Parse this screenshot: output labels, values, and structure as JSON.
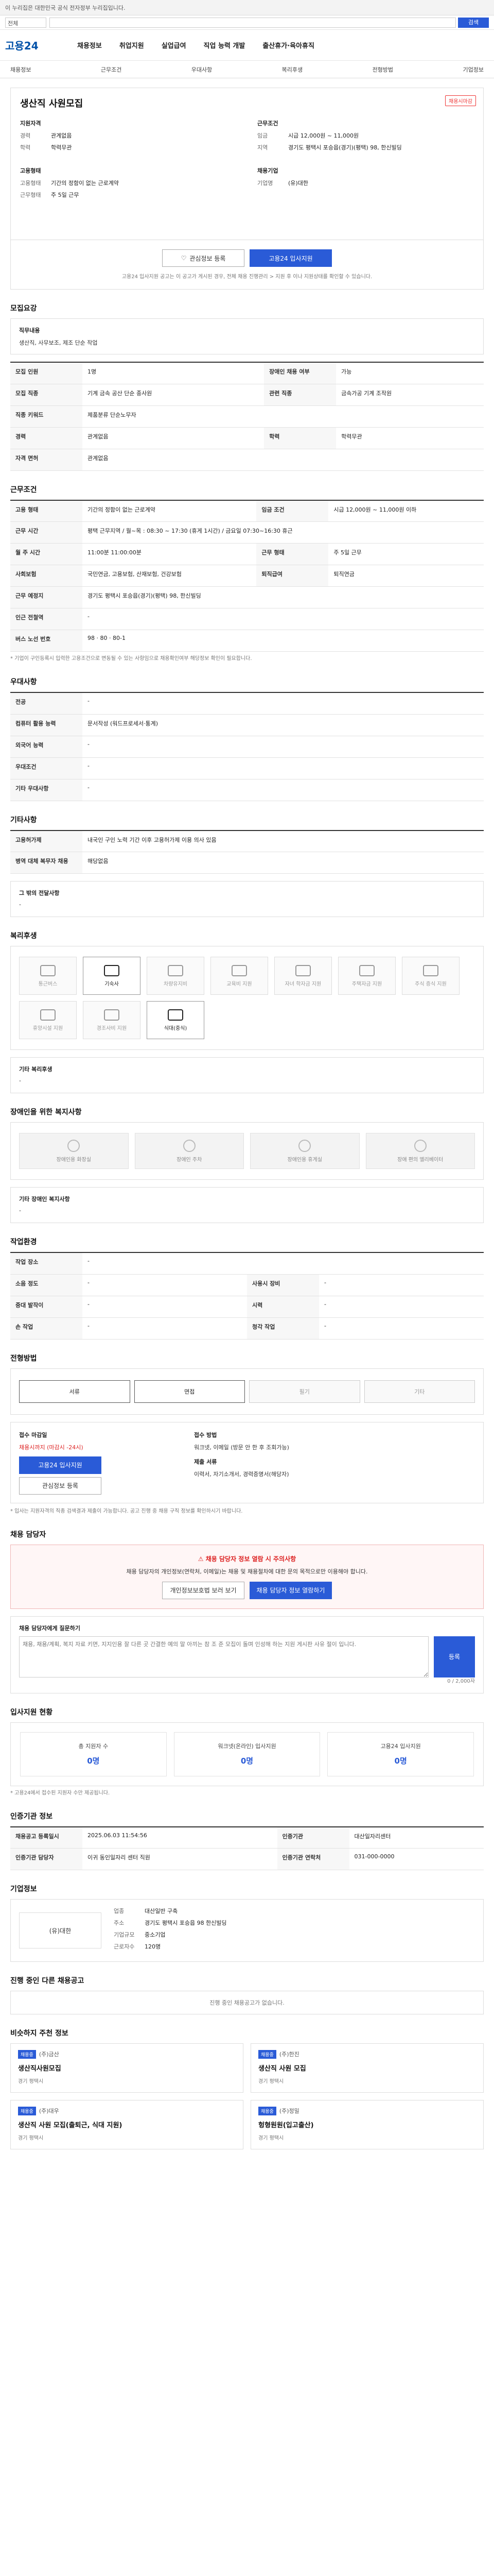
{
  "gov_bar": {
    "text": "이 누리집은 대한민국 공식 전자정부 누리집입니다."
  },
  "search": {
    "scope": "전체",
    "placeholder": "",
    "button": "검색"
  },
  "header": {
    "logo": "고용24",
    "gnb": [
      "채용정보",
      "취업지원",
      "실업급여",
      "직업 능력 개발",
      "출산휴가·육아휴직"
    ]
  },
  "subnav": [
    "채용정보",
    "근무조건",
    "우대사항",
    "복리후생",
    "전형방법",
    "기업정보"
  ],
  "summary": {
    "badge": "채용시마감",
    "title": "생산직 사원모집",
    "qual_head": "지원자격",
    "qual": [
      {
        "k": "경력",
        "v": "관계없음"
      },
      {
        "k": "학력",
        "v": "학력무관"
      }
    ],
    "work_head": "근무조건",
    "work": [
      {
        "k": "임금",
        "v": "시급 12,000원 ~ 11,000원"
      },
      {
        "k": "지역",
        "v": "경기도 평택시 포승읍(경기)(평택) 98, 한신빌딩"
      }
    ],
    "emp_head": "고용형태",
    "emp": [
      {
        "k": "고용형태",
        "v": "기간의 정함이 없는 근로계약"
      },
      {
        "k": "근무형태",
        "v": "주 5일 근무"
      }
    ],
    "corp_head": "채용기업",
    "corp": [
      {
        "k": "기업명",
        "v": "(유)대한"
      }
    ]
  },
  "actions": {
    "save": "관심정보 등록",
    "apply": "고용24 입사지원",
    "note": "고용24 입사지원 공고는 이 공고가 게시된 경우, 전체 채용 진행관리 > 지원 후 이나 지원상태를 확인할 수 있습니다."
  },
  "recruit": {
    "head": "모집요강",
    "duty_label": "직무내용",
    "duty": "생산직, 사무보조, 제조 단순 작업"
  },
  "recruit_table": [
    {
      "k": "모집 인원",
      "v": "1명",
      "k2": "장애인 채용 여부",
      "v2": "가능"
    },
    {
      "k": "모집 직종",
      "v": "기계 금속 공산 단순 종사원",
      "k2": "관련 직종",
      "v2": "금속가공 기계 조작원"
    },
    {
      "k": "직종 키워드",
      "v": "제품분류 단순노무자",
      "k2": "",
      "v2": ""
    },
    {
      "k": "경력",
      "v": "관계없음",
      "k2": "학력",
      "v2": "학력무관"
    },
    {
      "k": "자격 면허",
      "v": "관계없음",
      "k2": "",
      "v2": ""
    }
  ],
  "conditions": {
    "head": "근무조건"
  },
  "cond_table": [
    {
      "k": "고용 형태",
      "v": "기간의 정함이 없는 근로계약",
      "k2": "임금 조건",
      "v2": "시급 12,000원 ~ 11,000원 이하"
    },
    {
      "k": "근무 시간",
      "v": "평택 근무지역 / 월~목 : 08:30 ~ 17:30 (휴게 1시간) / 금요일 07:30~16:30 휴근",
      "k2": "",
      "v2": ""
    },
    {
      "k": "월 주 시간",
      "v": "11:00분 11:00:00분",
      "k2": "근무 형태",
      "v2": "주 5일 근무"
    },
    {
      "k": "사회보험",
      "v": "국민연금, 고용보험, 산재보험, 건강보험",
      "k2": "퇴직급여",
      "v2": "퇴직연금"
    },
    {
      "k": "근무 예정지",
      "v": "경기도 평택시 포승읍(경기)(평택) 98, 한신빌딩",
      "k2": "",
      "v2": ""
    },
    {
      "k": "인근 전철역",
      "v": "-",
      "k2": "",
      "v2": ""
    },
    {
      "k": "버스 노선 번호",
      "v": "98 · 80 · 80-1",
      "k2": "",
      "v2": ""
    }
  ],
  "cond_note": "* 기업이 구인등록시 입력한 고용조건으로 변동될 수 있는 사항임으로 채용확인여부 해당정보 확인이 필요합니다.",
  "pref": {
    "head": "우대사항"
  },
  "pref_table": [
    {
      "k": "전공",
      "v": "-"
    },
    {
      "k": "컴퓨터 활용 능력",
      "v": "문서작성 (워드프로세서·통계)"
    },
    {
      "k": "외국어 능력",
      "v": "-"
    },
    {
      "k": "우대조건",
      "v": "-"
    },
    {
      "k": "기타 우대사항",
      "v": "-"
    }
  ],
  "etc": {
    "head": "기타사항"
  },
  "etc_table": [
    {
      "k": "고용허가제",
      "v": "내국인 구인 노력 기간 이후 고용허가제 이용 의사 있음"
    },
    {
      "k": "병역 대체 복무자 채용",
      "v": "해당없음"
    }
  ],
  "etc_extra_label": "그 밖의 전달사항",
  "etc_extra": "-",
  "welfare": {
    "head": "복리후생",
    "extra_label": "기타 복리후생",
    "extra": "-"
  },
  "welfare_items": [
    {
      "label": "통근버스",
      "on": false
    },
    {
      "label": "기숙사",
      "on": true
    },
    {
      "label": "차량유지비",
      "on": false
    },
    {
      "label": "교육비 지원",
      "on": false
    },
    {
      "label": "자녀 학자금 지원",
      "on": false
    },
    {
      "label": "주택자금 지원",
      "on": false
    },
    {
      "label": "주식 증식 지원",
      "on": false
    },
    {
      "label": "휴양시설 지원",
      "on": false
    },
    {
      "label": "경조사비 지원",
      "on": false
    },
    {
      "label": "식대(중식)",
      "on": true
    }
  ],
  "disability": {
    "head": "장애인을 위한 복지사항",
    "extra_label": "기타 장애인 복지사항",
    "extra": "-"
  },
  "dis_items": [
    "장애인용 화장실",
    "장애인 주차",
    "장애인용 휴게실",
    "장애 편의 엘리베이터"
  ],
  "work_env": {
    "head": "작업환경"
  },
  "env_table": [
    {
      "k": "작업 장소",
      "v": "-",
      "k2": "",
      "v2": ""
    },
    {
      "k": "소음 정도",
      "v": "-",
      "k2": "사용시 장비",
      "v2": "-"
    },
    {
      "k": "중대 발작이",
      "v": "-",
      "k2": "시력",
      "v2": "-"
    },
    {
      "k": "손 작업",
      "v": "-",
      "k2": "청각 작업",
      "v2": "-"
    }
  ],
  "process": {
    "head": "전형방법"
  },
  "steps": [
    {
      "label": "서류",
      "on": true
    },
    {
      "label": "면접",
      "on": true
    },
    {
      "label": "필기",
      "on": false
    },
    {
      "label": "기타",
      "on": false
    }
  ],
  "apply": {
    "deadline_label": "접수 마감일",
    "deadline": "채용시까지 (마감시 -24시)",
    "btn_apply": "고용24 입사지원",
    "btn_save": "관심정보 등록",
    "method_label": "접수 방법",
    "methods": "워크넷, 이메일 (방문 안 한 후 조회가능)",
    "docs_label": "제출 서류",
    "docs": "이력서, 자기소개서, 경력증명서(해당자)"
  },
  "apply_notes": "* 입사는 지원자격의 직종 검색결과 제출이 가능합니다. 공고 진행 중 채용 구직 정보를 확인하시기 바랍니다.",
  "contact": {
    "head": "채용 담당자",
    "alert_head": "채용 담당자 정보 열람 시 주의사항",
    "alert_text": "채용 담당자의 개인정보(연락처, 이메일)는 채용 및 채용절차에 대한 문의 목적으로만 이용해야 합니다.",
    "btn1": "개인정보보호법 보러 보기",
    "btn2": "채용 담당자 정보 열람하기",
    "q_label": "채용 담당자에게 질문하기",
    "q_placeholder": "채용, 채용/계획, 복지 자료 키면, 지지인용 잘 다른 곳 간결한 예의 말 아끼는 참 조 준 모집이 돌며 인성해 하는 지원 게시판 사유 절이 입니다.",
    "q_count": "0 / 2,000자",
    "q_btn": "등록"
  },
  "apply_status": {
    "head": "입사지원 현황",
    "stats": [
      {
        "label": "총 지원자 수",
        "value": "0명"
      },
      {
        "label": "워크넷(온라인) 입사지원",
        "value": "0명"
      },
      {
        "label": "고용24 입사지원",
        "value": "0명"
      }
    ],
    "note": "* 고용24에서 접수된 지원자 수만 제공됩니다."
  },
  "info": {
    "head": "인증기관 정보"
  },
  "info_table": [
    {
      "k": "채용공고 등록일시",
      "v": "2025.06.03 11:54:56",
      "k2": "인증기관",
      "v2": "대산일자리센터"
    },
    {
      "k": "인증기관 담당자",
      "v": "이귀 동인일자리 센터 직원",
      "k2": "인증기관 연락처",
      "v2": "031-000-0000"
    }
  ],
  "company": {
    "head": "기업정보",
    "name": "(유)대한",
    "rows": [
      {
        "k": "업종",
        "v": "대산일반 구축"
      },
      {
        "k": "주소",
        "v": "경기도 평택시 포승읍 98 한신빌딩"
      },
      {
        "k": "기업규모",
        "v": "중소기업"
      },
      {
        "k": "근로자수",
        "v": "120명"
      }
    ]
  },
  "similar": {
    "head": "진행 중인 다른 채용공고",
    "empty": "진행 중인 채용공고가 없습니다."
  },
  "related": {
    "head": "비슷하지 주천 정보",
    "cards": [
      {
        "tag": "채용중",
        "org": "(주)금산",
        "title": "생산직사원모집",
        "meta": "경기 평택시"
      },
      {
        "tag": "채용중",
        "org": "(주)한진",
        "title": "생산직 사원 모집",
        "meta": "경기 평택시"
      },
      {
        "tag": "채용중",
        "org": "(주)대우",
        "title": "생산직 사원 모집(출퇴근, 식대 지원)",
        "meta": "경기 평택시"
      },
      {
        "tag": "채용중",
        "org": "(주)정밀",
        "title": "헝형원원(입고출산)",
        "meta": "경기 평택시"
      }
    ]
  }
}
